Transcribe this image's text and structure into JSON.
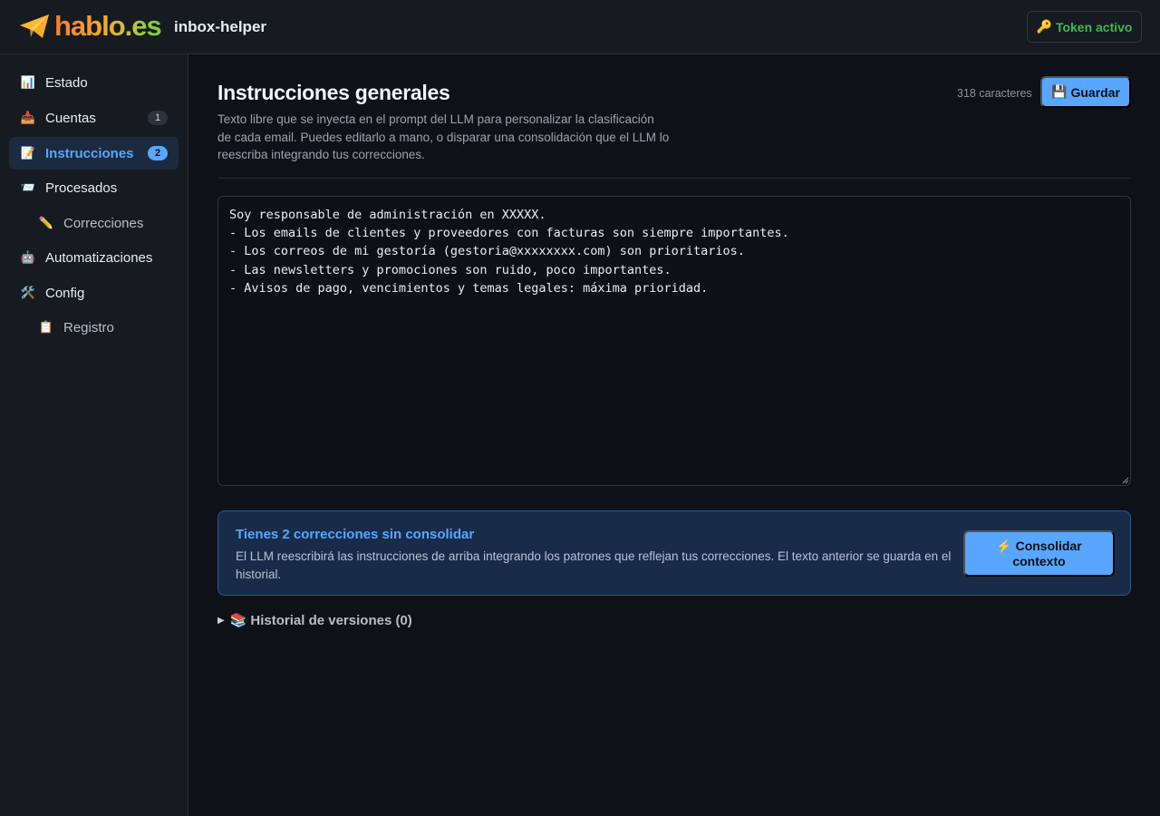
{
  "header": {
    "brand": "hablo.es",
    "app_name": "inbox-helper",
    "token_label": "Token activo",
    "token_icon": "key-icon",
    "brand_colors": [
      "#ff7a2f",
      "#f7a928",
      "#6fcf3c"
    ]
  },
  "sidebar": {
    "items": [
      {
        "label": "Estado",
        "icon": "chart-icon"
      },
      {
        "label": "Cuentas",
        "icon": "inbox-tray-icon",
        "badge": "1"
      },
      {
        "label": "Instrucciones",
        "icon": "memo-icon",
        "badge": "2",
        "active": true
      },
      {
        "label": "Procesados",
        "icon": "envelope-stack-icon"
      },
      {
        "label": "Correcciones",
        "icon": "pencil-icon",
        "sub": true
      },
      {
        "label": "Automatizaciones",
        "icon": "robot-icon"
      },
      {
        "label": "Config",
        "icon": "tools-icon"
      },
      {
        "label": "Registro",
        "icon": "clipboard-icon",
        "sub": true
      }
    ]
  },
  "main": {
    "title": "Instrucciones generales",
    "description": "Texto libre que se inyecta en el prompt del LLM para personalizar la clasificación de cada email. Puedes editarlo a mano, o disparar una consolidación que el LLM lo reescriba integrando tus correcciones.",
    "char_count": "318 caracteres",
    "save_label": "Guardar",
    "save_icon": "floppy-disk-icon",
    "editor_text": "Soy responsable de administración en XXXXX.\n- Los emails de clientes y proveedores con facturas son siempre importantes.\n- Los correos de mi gestoría (gestoria@xxxxxxxx.com) son prioritarios.\n- Las newsletters y promociones son ruido, poco importantes.\n- Avisos de pago, vencimientos y temas legales: máxima prioridad.",
    "callout": {
      "title": "Tienes 2 correcciones sin consolidar",
      "text": "El LLM reescribirá las instrucciones de arriba integrando los patrones que reflejan tus correcciones. El texto anterior se guarda en el historial.",
      "button_line1": "Consolidar",
      "button_line2": "contexto",
      "button_icon": "lightning-icon"
    },
    "history_label": "Historial de versiones (0)",
    "history_icon": "books-icon"
  },
  "colors": {
    "accent": "#58a6ff",
    "success": "#3fb950",
    "background": "#0e1117",
    "surface": "#161b22"
  }
}
